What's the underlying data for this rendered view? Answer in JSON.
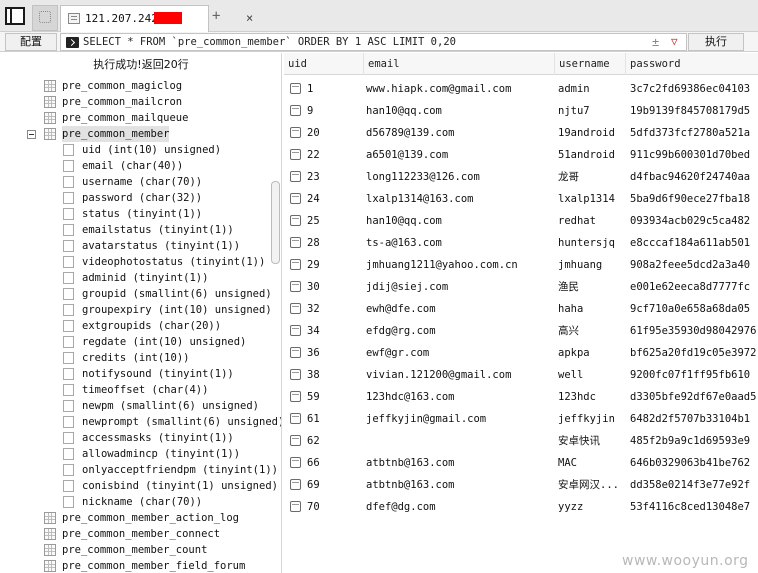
{
  "tabs": {
    "active_label": "121.207.242.",
    "close_glyph": "×",
    "add_glyph": "+"
  },
  "toolbar": {
    "config_label": "配置",
    "sql": "SELECT * FROM `pre_common_member` ORDER BY 1 ASC LIMIT 0,20",
    "plusminus": "±",
    "dropdown_glyph": "▽",
    "run_label": "执行"
  },
  "tree": {
    "status": "执行成功!返回20行",
    "tables_before": [
      "pre_common_magiclog",
      "pre_common_mailcron",
      "pre_common_mailqueue"
    ],
    "expanded_table": "pre_common_member",
    "columns": [
      "uid (int(10) unsigned)",
      "email (char(40))",
      "username (char(70))",
      "password (char(32))",
      "status (tinyint(1))",
      "emailstatus (tinyint(1))",
      "avatarstatus (tinyint(1))",
      "videophotostatus (tinyint(1))",
      "adminid (tinyint(1))",
      "groupid (smallint(6) unsigned)",
      "groupexpiry (int(10) unsigned)",
      "extgroupids (char(20))",
      "regdate (int(10) unsigned)",
      "credits (int(10))",
      "notifysound (tinyint(1))",
      "timeoffset (char(4))",
      "newpm (smallint(6) unsigned)",
      "newprompt (smallint(6) unsigned)",
      "accessmasks (tinyint(1))",
      "allowadmincp (tinyint(1))",
      "onlyacceptfriendpm (tinyint(1))",
      "conisbind (tinyint(1) unsigned)",
      "nickname (char(70))"
    ],
    "tables_after": [
      "pre_common_member_action_log",
      "pre_common_member_connect",
      "pre_common_member_count",
      "pre_common_member_field_forum"
    ]
  },
  "grid": {
    "headers": [
      "uid",
      "email",
      "username",
      "password"
    ],
    "rows": [
      [
        "1",
        "www.hiapk.com@gmail.com",
        "admin",
        "3c7c2fd69386ec04103"
      ],
      [
        "9",
        "han10@qq.com",
        "njtu7",
        "19b9139f845708179d5"
      ],
      [
        "20",
        "d56789@139.com",
        "19android",
        "5dfd373fcf2780a521a"
      ],
      [
        "22",
        "a6501@139.com",
        "51android",
        "911c99b600301d70bed"
      ],
      [
        "23",
        "long112233@126.com",
        "龙哥",
        "d4fbac94620f24740aa"
      ],
      [
        "24",
        "lxalp1314@163.com",
        "lxalp1314",
        "5ba9d6f90ece27fba18"
      ],
      [
        "25",
        "han10@qq.com",
        "redhat",
        "093934acb029c5ca482"
      ],
      [
        "28",
        "ts-a@163.com",
        "huntersjq",
        "e8cccaf184a611ab501"
      ],
      [
        "29",
        "jmhuang1211@yahoo.com.cn",
        "jmhuang",
        "908a2feee5dcd2a3a40"
      ],
      [
        "30",
        "jdij@siej.com",
        "渔民",
        "e001e62eeca8d7777fc"
      ],
      [
        "32",
        "ewh@dfe.com",
        "haha",
        "9cf710a0e658a68da05"
      ],
      [
        "34",
        "efdg@rg.com",
        "高兴",
        "61f95e35930d98042976"
      ],
      [
        "36",
        "ewf@gr.com",
        "apkpa",
        "bf625a20fd19c05e3972"
      ],
      [
        "38",
        "vivian.121200@gmail.com",
        "well",
        "9200fc07f1ff95fb610"
      ],
      [
        "59",
        "123hdc@163.com",
        "123hdc",
        "d3305bfe92df67e0aad5"
      ],
      [
        "61",
        "jeffkyjin@gmail.com",
        "jeffkyjin",
        "6482d2f5707b33104b1"
      ],
      [
        "62",
        "",
        "安卓快讯",
        "485f2b9a9c1d69593e9"
      ],
      [
        "66",
        "atbtnb@163.com",
        "MAC",
        "646b0329063b41be762"
      ],
      [
        "69",
        "atbtnb@163.com",
        "安卓网汉...",
        "dd358e0214f3e77e92f"
      ],
      [
        "70",
        "dfef@dg.com",
        "yyzz",
        "53f4116c8ced13048e7"
      ]
    ]
  },
  "watermark": "www.wooyun.org",
  "colors": {
    "redaction": "#ff0000",
    "tab_bar_bg": "#e9e9e9",
    "selected_node_bg": "#e2e2e2"
  }
}
